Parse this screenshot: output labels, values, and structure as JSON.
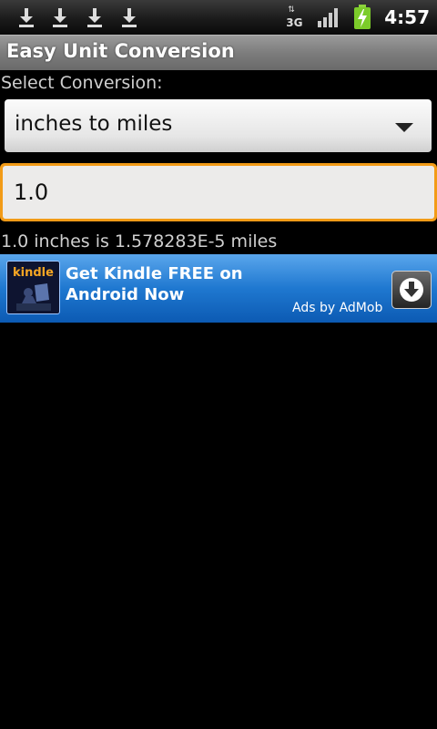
{
  "status_bar": {
    "time": "4:57",
    "network_label": "3G",
    "icons": [
      "download-icon",
      "download-icon",
      "download-icon",
      "download-icon",
      "network-3g-icon",
      "signal-icon",
      "battery-charging-icon"
    ]
  },
  "app": {
    "title": "Easy Unit Conversion"
  },
  "form": {
    "select_label": "Select Conversion:",
    "conversion_selected": "inches to miles",
    "input_value": "1.0",
    "result_text": "1.0 inches is 1.578283E-5 miles"
  },
  "ad": {
    "logo_text": "kindle",
    "headline": "Get Kindle FREE on Android Now",
    "sponsor": "Ads by AdMob",
    "icon": "download-button-icon",
    "colors": {
      "banner": "#1f78d0",
      "accent": "#f29b17"
    }
  }
}
